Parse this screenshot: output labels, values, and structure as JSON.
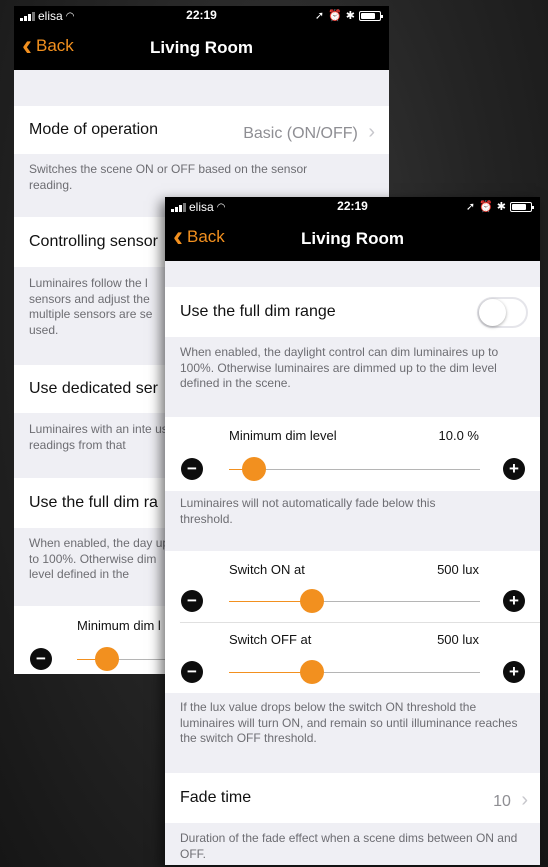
{
  "back_screen": {
    "status": {
      "carrier": "elisa",
      "time": "22:19"
    },
    "nav": {
      "back": "Back",
      "title": "Living Room"
    },
    "mode_row": {
      "label": "Mode of operation",
      "value": "Basic (ON/OFF)"
    },
    "mode_footer": "Switches the scene ON or OFF based on the sensor reading.",
    "controlling_row": {
      "label": "Controlling sensor"
    },
    "controlling_footer": "Luminaires follow the l sensors and adjust the multiple sensors are se used.",
    "dedicated_row": {
      "label": "Use dedicated ser"
    },
    "dedicated_footer": "Luminaires with an inte use readings from that",
    "fulldim_row": {
      "label": "Use the full dim ra"
    },
    "fulldim_footer": "When enabled, the day up to 100%. Otherwise dim level defined in the",
    "min_dim": {
      "label": "Minimum dim l",
      "fraction": 0.1
    }
  },
  "front_screen": {
    "status": {
      "carrier": "elisa",
      "time": "22:19"
    },
    "nav": {
      "back": "Back",
      "title": "Living Room"
    },
    "fulldim": {
      "label": "Use the full dim range",
      "enabled": false
    },
    "fulldim_footer": "When enabled, the daylight control can dim luminaires up to 100%. Otherwise luminaires are dimmed up to the dim level defined in the scene.",
    "min_dim": {
      "label": "Minimum dim level",
      "value": "10.0 %",
      "fraction": 0.1
    },
    "min_dim_footer": "Luminaires will not automatically fade below this threshold.",
    "switch_on": {
      "label": "Switch ON at",
      "value": "500 lux",
      "fraction": 0.33
    },
    "switch_off": {
      "label": "Switch OFF at",
      "value": "500 lux",
      "fraction": 0.33
    },
    "switch_footer": "If the lux value drops below the switch ON threshold the luminaires will turn ON, and remain so until illuminance reaches the switch OFF threshold.",
    "fade": {
      "label": "Fade time",
      "value": "10"
    },
    "fade_footer": "Duration of the fade effect when a scene dims between ON and OFF."
  },
  "glyphs": {
    "back_chevron": "‹",
    "chevron": "›",
    "minus": "−",
    "plus": "+",
    "location": "➚",
    "alarm": "⏰",
    "bluetooth": "✱"
  },
  "colors": {
    "accent": "#f2901f",
    "nav_background": "#000000",
    "page_background": "#efeff4"
  }
}
